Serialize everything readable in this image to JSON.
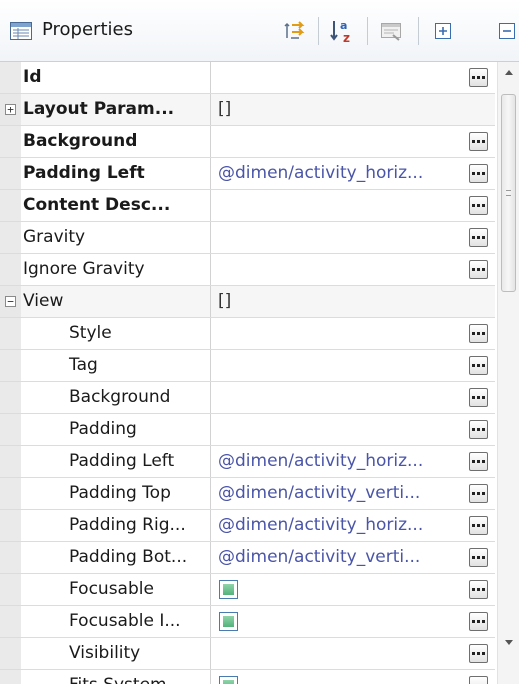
{
  "header": {
    "title": "Properties",
    "icons": [
      "properties-view-icon",
      "show-categories-icon",
      "sort-alphabetically-icon",
      "restore-defaults-icon",
      "expand-all-icon",
      "collapse-all-icon"
    ]
  },
  "properties": [
    {
      "name": "Id",
      "bold": true,
      "value": "",
      "editor": true
    },
    {
      "name": "Layout Param...",
      "bold": true,
      "value": "[]",
      "expander": "plus",
      "editor": false
    },
    {
      "name": "Background",
      "bold": true,
      "value": "",
      "editor": true
    },
    {
      "name": "Padding Left",
      "bold": true,
      "value": "@dimen/activity_horiz...",
      "editor": true
    },
    {
      "name": "Content Desc...",
      "bold": true,
      "value": "",
      "editor": true
    },
    {
      "name": "Gravity",
      "bold": false,
      "value": "",
      "editor": true
    },
    {
      "name": "Ignore Gravity",
      "bold": false,
      "value": "",
      "editor": true
    },
    {
      "name": "View",
      "bold": false,
      "value": "[]",
      "expander": "minus",
      "editor": false
    },
    {
      "name": "Style",
      "bold": false,
      "value": "",
      "indent": true,
      "editor": true
    },
    {
      "name": "Tag",
      "bold": false,
      "value": "",
      "indent": true,
      "editor": true
    },
    {
      "name": "Background",
      "bold": false,
      "value": "",
      "indent": true,
      "editor": true
    },
    {
      "name": "Padding",
      "bold": false,
      "value": "",
      "indent": true,
      "editor": true
    },
    {
      "name": "Padding Left",
      "bold": false,
      "value": "@dimen/activity_horiz...",
      "indent": true,
      "editor": true
    },
    {
      "name": "Padding Top",
      "bold": false,
      "value": "@dimen/activity_verti...",
      "indent": true,
      "editor": true
    },
    {
      "name": "Padding Rig...",
      "bold": false,
      "value": "@dimen/activity_horiz...",
      "indent": true,
      "editor": true
    },
    {
      "name": "Padding Bot...",
      "bold": false,
      "value": "@dimen/activity_verti...",
      "indent": true,
      "editor": true
    },
    {
      "name": "Focusable",
      "bold": false,
      "value": "",
      "checkbox": true,
      "indent": true,
      "editor": true
    },
    {
      "name": "Focusable I...",
      "bold": false,
      "value": "",
      "checkbox": true,
      "indent": true,
      "editor": true
    },
    {
      "name": "Visibility",
      "bold": false,
      "value": "",
      "indent": true,
      "editor": true
    },
    {
      "name": "Fits System...",
      "bold": false,
      "value": "",
      "checkbox": true,
      "indent": true,
      "editor": true
    }
  ],
  "colors": {
    "value_link": "#4a55a8",
    "checkbox_fill": "#53b27a"
  }
}
